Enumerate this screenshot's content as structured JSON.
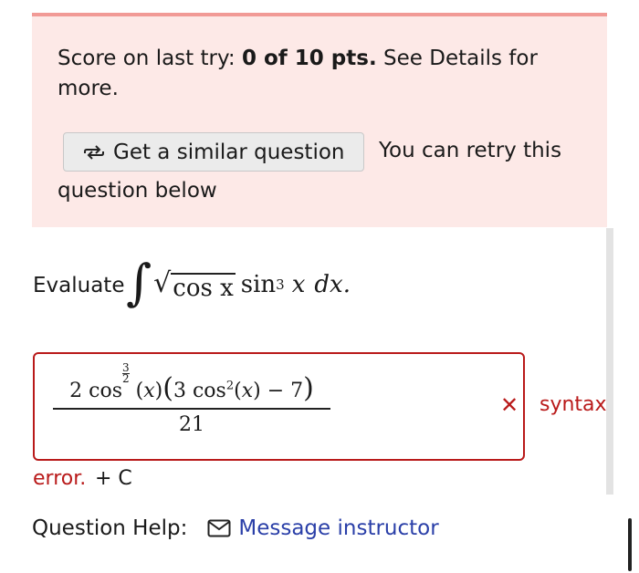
{
  "alert": {
    "score_label": "Score on last try:",
    "score_value": "0 of 10 pts.",
    "details_text": "See Details for more.",
    "similar_button_label": "Get a similar question",
    "retry_text_1": "You can retry this",
    "retry_text_2": "question below"
  },
  "question": {
    "prompt_word": "Evaluate",
    "integrand_sqrt": "cos x",
    "integrand_rest_fn": "sin",
    "integrand_rest_exp": "3",
    "integrand_var": "x",
    "integrand_d": "dx."
  },
  "answer": {
    "numerator_coef": "2",
    "numerator_fn": "cos",
    "exp_num": "3",
    "exp_den": "2",
    "inner_coef": "3",
    "inner_exp": "2",
    "minus": "− 7",
    "denominator": "21"
  },
  "feedback": {
    "x_mark": "✕",
    "syntax_label": "syntax",
    "error_label": "error.",
    "plus_c": "+ C"
  },
  "help": {
    "label": "Question Help:",
    "message_link": "Message instructor"
  },
  "colors": {
    "alert_bg": "#fde9e7",
    "alert_border": "#f19a96",
    "error_red": "#b91a1a",
    "link_blue": "#2a3fa8"
  }
}
